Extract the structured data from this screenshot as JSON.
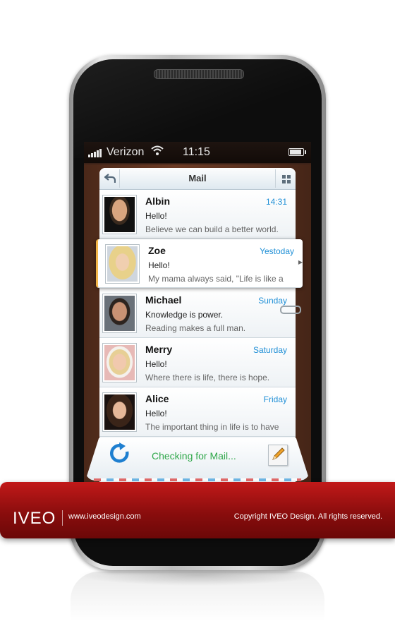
{
  "status_bar": {
    "carrier": "Verizon",
    "time": "11:15",
    "signal_icon": "signal-bars-icon",
    "wifi_icon": "wifi-icon",
    "battery_icon": "battery-icon"
  },
  "header": {
    "title": "Mail",
    "back_icon": "back-arrow-icon",
    "grid_icon": "grid-icon"
  },
  "messages": [
    {
      "name": "Albin",
      "date": "14:31",
      "subject": "Hello!",
      "preview": "Believe we can build a better world."
    },
    {
      "name": "Zoe",
      "date": "Yestoday",
      "subject": "Hello!",
      "preview": "My mama always said, \"Life is like a"
    },
    {
      "name": "Michael",
      "date": "Sunday",
      "subject": "Knowledge is power.",
      "preview": "Reading makes a full man."
    },
    {
      "name": "Merry",
      "date": "Saturday",
      "subject": "Hello!",
      "preview": "Where there is life, there is hope."
    },
    {
      "name": "Alice",
      "date": "Friday",
      "subject": "Hello!",
      "preview": "The important thing in life is to have"
    }
  ],
  "footer": {
    "status": "Checking for Mail...",
    "refresh_icon": "refresh-icon",
    "compose_icon": "compose-icon"
  },
  "banner": {
    "logo": "IVEO",
    "site": "www.iveodesign.com",
    "copyright": "Copyright IVEO Design. All rights reserved."
  },
  "colors": {
    "accent": "#1f8fd6",
    "status_green": "#31a84b",
    "banner_red": "#a81212",
    "selected_marker": "#f2b54a"
  }
}
